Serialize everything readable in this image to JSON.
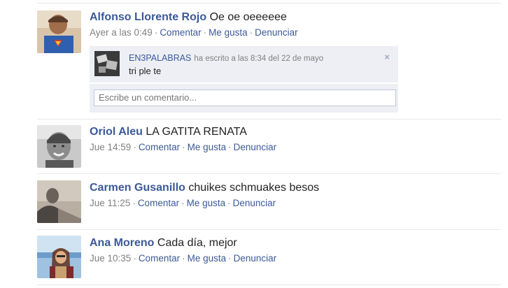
{
  "feed": {
    "stories": [
      {
        "author": "Alfonso Llorente Rojo",
        "text": "Oe oe oeeeeee",
        "time": "Ayer a las 0:49",
        "actions": {
          "comment": "Comentar",
          "like": "Me gusta",
          "report": "Denunciar"
        },
        "comment": {
          "author": "EN3PALABRAS",
          "time": "ha escrito a las 8:34 del 22 de mayo",
          "text": "tri ple te",
          "close": "×"
        },
        "reply_placeholder": "Escribe un comentario..."
      },
      {
        "author": "Oriol Aleu",
        "text": "LA GATITA RENATA",
        "time": "Jue 14:59",
        "actions": {
          "comment": "Comentar",
          "like": "Me gusta",
          "report": "Denunciar"
        }
      },
      {
        "author": "Carmen Gusanillo",
        "text": "chuikes schmuakes besos",
        "time": "Jue 11:25",
        "actions": {
          "comment": "Comentar",
          "like": "Me gusta",
          "report": "Denunciar"
        }
      },
      {
        "author": "Ana Moreno",
        "text": "Cada día, mejor",
        "time": "Jue 10:35",
        "actions": {
          "comment": "Comentar",
          "like": "Me gusta",
          "report": "Denunciar"
        }
      }
    ]
  },
  "colors": {
    "link": "#3b5998",
    "meta_gray": "#808080",
    "comment_bg": "#edeff4",
    "separator": "#e9e9e9"
  }
}
